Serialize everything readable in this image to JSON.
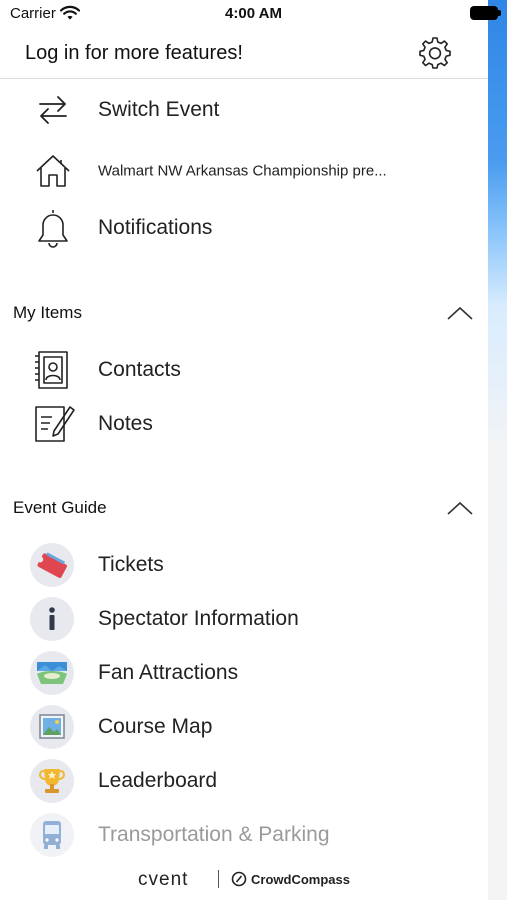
{
  "status_bar": {
    "carrier": "Carrier",
    "time": "4:00 AM"
  },
  "header": {
    "login_prompt": "Log in for more features!",
    "settings_icon": "gear-icon"
  },
  "top_items": [
    {
      "label": "Switch Event",
      "icon": "switch-arrows-icon"
    },
    {
      "label": "Walmart NW Arkansas Championship pre...",
      "icon": "home-icon"
    },
    {
      "label": "Notifications",
      "icon": "bell-icon"
    }
  ],
  "my_items": {
    "title": "My Items",
    "items": [
      {
        "label": "Contacts",
        "icon": "contacts-book-icon"
      },
      {
        "label": "Notes",
        "icon": "notes-pencil-icon"
      }
    ]
  },
  "event_guide": {
    "title": "Event Guide",
    "items": [
      {
        "label": "Tickets",
        "icon": "ticket-icon"
      },
      {
        "label": "Spectator Information",
        "icon": "info-icon"
      },
      {
        "label": "Fan Attractions",
        "icon": "landscape-icon"
      },
      {
        "label": "Course Map",
        "icon": "map-picture-icon"
      },
      {
        "label": "Leaderboard",
        "icon": "trophy-icon"
      },
      {
        "label": "Transportation & Parking",
        "icon": "bus-icon"
      }
    ]
  },
  "footer": {
    "brand": "cvent",
    "partner": "CrowdCompass"
  },
  "colors": {
    "accent_edge": "#2f86e6",
    "icon_circle": "#e7e9ee"
  }
}
